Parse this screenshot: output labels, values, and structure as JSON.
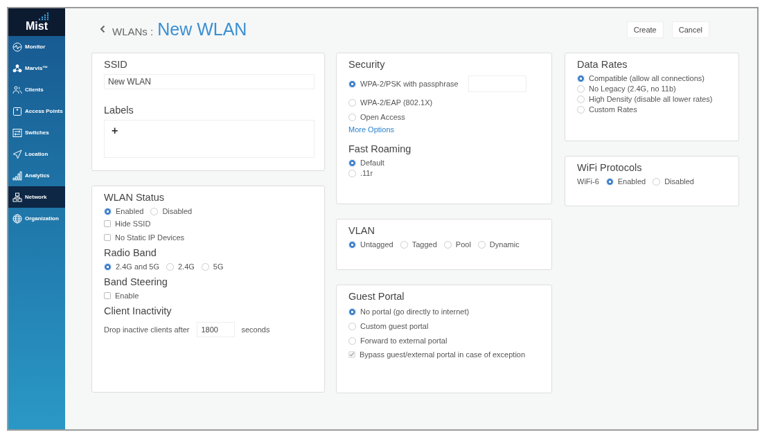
{
  "sidebar": {
    "logo": "Mist",
    "items": [
      {
        "label": "Monitor",
        "selected": false
      },
      {
        "label": "Marvis™",
        "selected": false
      },
      {
        "label": "Clients",
        "selected": false
      },
      {
        "label": "Access Points",
        "selected": false
      },
      {
        "label": "Switches",
        "selected": false
      },
      {
        "label": "Location",
        "selected": false
      },
      {
        "label": "Analytics",
        "selected": false
      },
      {
        "label": "Network",
        "selected": true
      },
      {
        "label": "Organization",
        "selected": false
      }
    ]
  },
  "header": {
    "back": "WLANs :",
    "title": "New WLAN",
    "buttons": [
      "Create",
      "Cancel"
    ]
  },
  "columns": [
    [
      {
        "sections": [
          {
            "heading": "SSID",
            "items": [
              {
                "kind": "text_field",
                "value": "New WLAN"
              }
            ]
          },
          {
            "heading": "Labels",
            "items": [
              {
                "kind": "tag_area",
                "add": "+"
              }
            ]
          }
        ]
      },
      {
        "sections": [
          {
            "heading": "WLAN Status",
            "items": [
              {
                "kind": "radio_row",
                "options": [
                  {
                    "label": "Enabled",
                    "selected": true
                  },
                  {
                    "label": "Disabled",
                    "selected": false
                  }
                ]
              },
              {
                "kind": "checkbox",
                "label": "Hide SSID",
                "checked": false,
                "disabled": false
              },
              {
                "kind": "checkbox",
                "label": "No Static IP Devices",
                "checked": false,
                "disabled": false
              }
            ]
          },
          {
            "heading": "Radio Band",
            "items": [
              {
                "kind": "radio_row",
                "options": [
                  {
                    "label": "2.4G and 5G",
                    "selected": true
                  },
                  {
                    "label": "2.4G",
                    "selected": false
                  },
                  {
                    "label": "5G",
                    "selected": false
                  }
                ]
              }
            ]
          },
          {
            "heading": "Band Steering",
            "items": [
              {
                "kind": "checkbox",
                "label": "Enable",
                "checked": false,
                "disabled": false
              }
            ]
          },
          {
            "heading": "Client Inactivity",
            "items": [
              {
                "kind": "number_row",
                "prefix": "Drop inactive clients after",
                "value": "1800",
                "suffix": "seconds"
              }
            ]
          }
        ]
      }
    ],
    [
      {
        "sections": [
          {
            "heading": "Security",
            "items": [
              {
                "kind": "radio_stack",
                "options": [
                  {
                    "label": "WPA-2/PSK with passphrase",
                    "selected": true,
                    "passphrase_field": true
                  },
                  {
                    "label": "WPA-2/EAP (802.1X)",
                    "selected": false
                  },
                  {
                    "label": "Open Access",
                    "selected": false
                  }
                ]
              },
              {
                "kind": "link",
                "label": "More Options"
              }
            ]
          },
          {
            "heading": "Fast Roaming",
            "items": [
              {
                "kind": "radio_list",
                "options": [
                  {
                    "label": "Default",
                    "selected": true
                  },
                  {
                    "label": ".11r",
                    "selected": false
                  }
                ]
              }
            ]
          }
        ]
      },
      {
        "sections": [
          {
            "heading": "VLAN",
            "items": [
              {
                "kind": "radio_row",
                "options": [
                  {
                    "label": "Untagged",
                    "selected": true
                  },
                  {
                    "label": "Tagged",
                    "selected": false
                  },
                  {
                    "label": "Pool",
                    "selected": false
                  },
                  {
                    "label": "Dynamic",
                    "selected": false
                  }
                ]
              }
            ]
          }
        ]
      },
      {
        "sections": [
          {
            "heading": "Guest Portal",
            "items": [
              {
                "kind": "radio_stack",
                "options": [
                  {
                    "label": "No portal (go directly to internet)",
                    "selected": true
                  },
                  {
                    "label": "Custom guest portal",
                    "selected": false
                  },
                  {
                    "label": "Forward to external portal",
                    "selected": false
                  }
                ]
              },
              {
                "kind": "checkbox",
                "label": "Bypass guest/external portal in case of exception",
                "checked": true,
                "disabled": true
              }
            ]
          }
        ]
      }
    ],
    [
      {
        "sections": [
          {
            "heading": "Data Rates",
            "items": [
              {
                "kind": "radio_list",
                "options": [
                  {
                    "label": "Compatible (allow all connections)",
                    "selected": true
                  },
                  {
                    "label": "No Legacy (2.4G, no 11b)",
                    "selected": false
                  },
                  {
                    "label": "High Density (disable all lower rates)",
                    "selected": false
                  },
                  {
                    "label": "Custom Rates",
                    "selected": false
                  }
                ]
              }
            ]
          }
        ]
      },
      {
        "sections": [
          {
            "heading": "WiFi Protocols",
            "items": [
              {
                "kind": "radio_row",
                "label": "WiFi-6",
                "options": [
                  {
                    "label": "Enabled",
                    "selected": true
                  },
                  {
                    "label": "Disabled",
                    "selected": false
                  }
                ]
              }
            ]
          }
        ]
      }
    ]
  ]
}
